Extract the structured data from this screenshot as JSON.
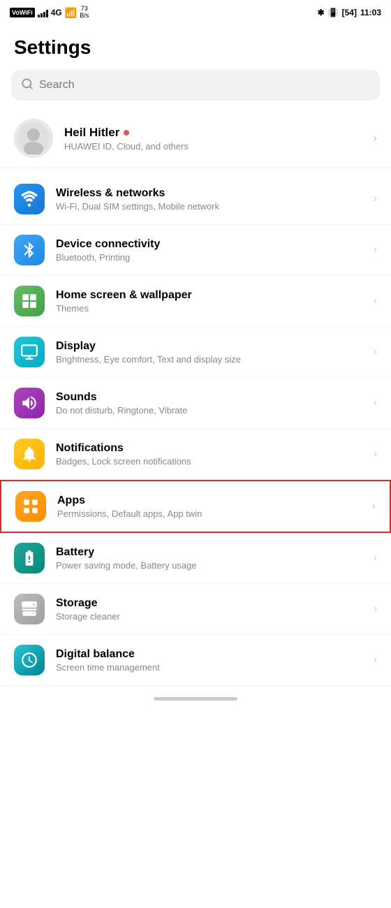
{
  "statusBar": {
    "left": {
      "vowifi": "VoWiFi",
      "network": "4G",
      "speed": "73\nB/s"
    },
    "right": {
      "bluetooth": "✱",
      "battery": "54",
      "time": "11:03"
    }
  },
  "pageTitle": "Settings",
  "search": {
    "placeholder": "Search"
  },
  "profile": {
    "name": "Heil Hitler",
    "subtitle": "HUAWEI ID, Cloud, and others"
  },
  "menuItems": [
    {
      "id": "wireless",
      "title": "Wireless & networks",
      "subtitle": "Wi-Fi, Dual SIM settings, Mobile network",
      "iconColor": "bg-blue",
      "iconType": "wifi"
    },
    {
      "id": "connectivity",
      "title": "Device connectivity",
      "subtitle": "Bluetooth, Printing",
      "iconColor": "bg-blue2",
      "iconType": "bluetooth"
    },
    {
      "id": "homescreen",
      "title": "Home screen & wallpaper",
      "subtitle": "Themes",
      "iconColor": "bg-green",
      "iconType": "homescreen"
    },
    {
      "id": "display",
      "title": "Display",
      "subtitle": "Brightness, Eye comfort, Text and display size",
      "iconColor": "bg-teal",
      "iconType": "display"
    },
    {
      "id": "sounds",
      "title": "Sounds",
      "subtitle": "Do not disturb, Ringtone, Vibrate",
      "iconColor": "bg-purple",
      "iconType": "sounds"
    },
    {
      "id": "notifications",
      "title": "Notifications",
      "subtitle": "Badges, Lock screen notifications",
      "iconColor": "bg-yellow",
      "iconType": "notifications"
    },
    {
      "id": "apps",
      "title": "Apps",
      "subtitle": "Permissions, Default apps, App twin",
      "iconColor": "bg-orange",
      "iconType": "apps",
      "highlighted": true
    },
    {
      "id": "battery",
      "title": "Battery",
      "subtitle": "Power saving mode, Battery usage",
      "iconColor": "bg-green2",
      "iconType": "battery"
    },
    {
      "id": "storage",
      "title": "Storage",
      "subtitle": "Storage cleaner",
      "iconColor": "bg-gray",
      "iconType": "storage"
    },
    {
      "id": "digitalbalance",
      "title": "Digital balance",
      "subtitle": "Screen time management",
      "iconColor": "bg-teal2",
      "iconType": "digitalbalance"
    }
  ],
  "homeIndicator": true
}
